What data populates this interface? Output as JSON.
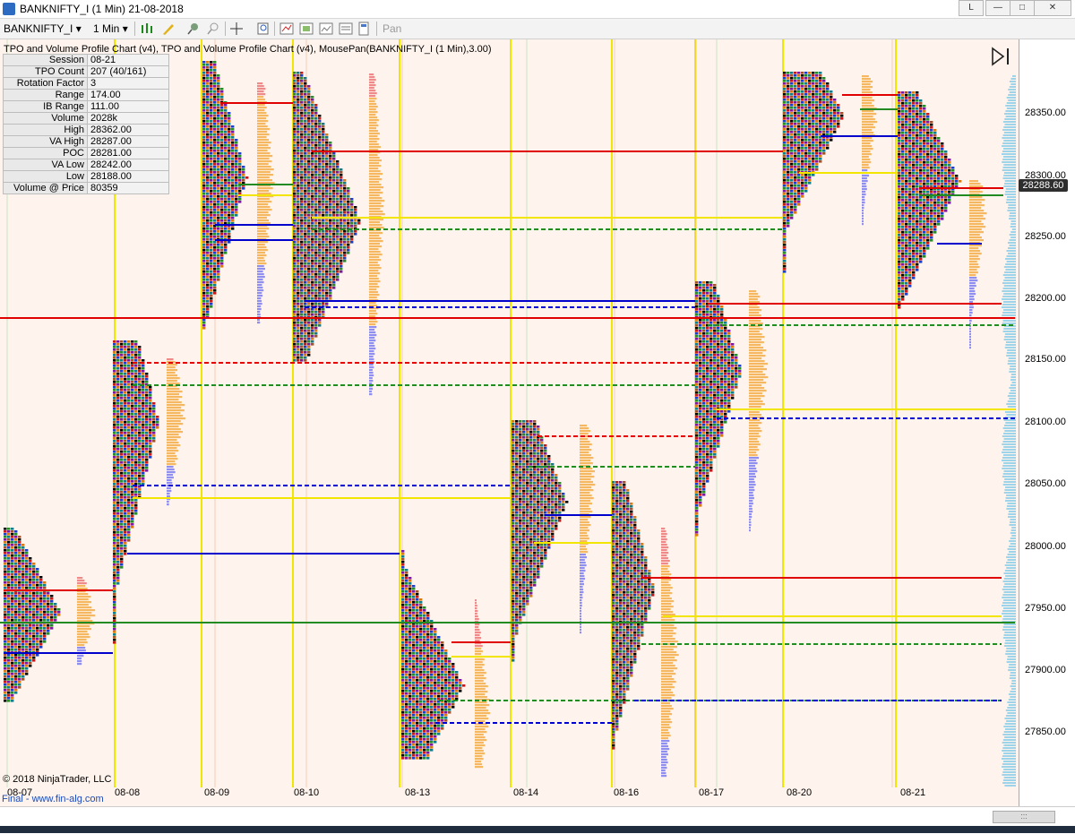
{
  "window": {
    "title": "BANKNIFTY_I (1 Min)  21-08-2018",
    "buttons": [
      "L",
      "—",
      "□",
      "✕"
    ]
  },
  "toolbar": {
    "instrument": "BANKNIFTY_I",
    "interval": "1 Min",
    "pan_label": "Pan"
  },
  "chart": {
    "header": "TPO and Volume Profile Chart (v4),  TPO and Volume Profile Chart (v4),  MousePan(BANKNIFTY_I (1 Min),3.00)",
    "info": [
      {
        "k": "Session",
        "v": "08-21"
      },
      {
        "k": "TPO Count",
        "v": "207 (40/161)"
      },
      {
        "k": "Rotation Factor",
        "v": "3"
      },
      {
        "k": "Range",
        "v": "174.00"
      },
      {
        "k": "IB Range",
        "v": "111.00"
      },
      {
        "k": "Volume",
        "v": "2028k"
      },
      {
        "k": "High",
        "v": "28362.00"
      },
      {
        "k": "VA High",
        "v": "28287.00"
      },
      {
        "k": "POC",
        "v": "28281.00"
      },
      {
        "k": "VA Low",
        "v": "28242.00"
      },
      {
        "k": "Low",
        "v": "28188.00"
      },
      {
        "k": "Volume @ Price",
        "v": "80359"
      }
    ],
    "y_labels": [
      "28350.00",
      "28300.00",
      "28250.00",
      "28200.00",
      "28150.00",
      "28100.00",
      "28050.00",
      "28000.00",
      "27950.00",
      "27900.00",
      "27850.00"
    ],
    "current_price": "28288.60",
    "x_labels": [
      "08-07",
      "08-08",
      "08-09",
      "08-10",
      "08-13",
      "08-14",
      "08-16",
      "08-17",
      "08-20",
      "08-21"
    ],
    "copyright": "© 2018 NinjaTrader, LLC",
    "footer_link": "Final - www.fin-alg.com"
  },
  "colors": {
    "background": "#fff4ed",
    "poc_line": "#228b22",
    "va_high_line": "#e00000",
    "va_low_line": "#0000cc",
    "session_line": "#f2e600",
    "volume_profile": "#f5b860",
    "composite_profile": "#9dd4ea"
  }
}
